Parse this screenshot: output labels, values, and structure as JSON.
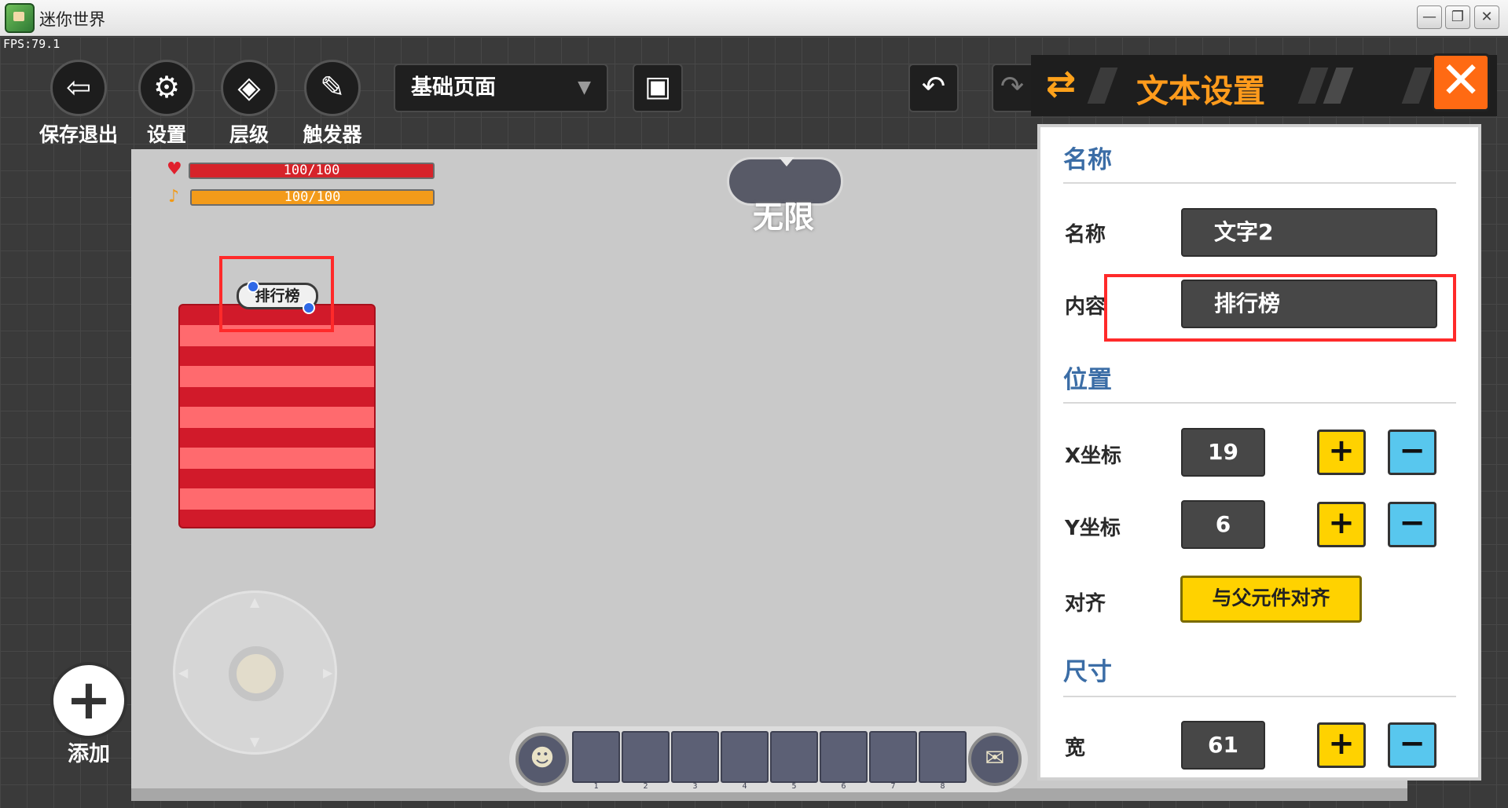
{
  "window": {
    "title": "迷你世界",
    "fps": "FPS:79.1",
    "minimize": "—",
    "maximize": "❐",
    "close": "✕"
  },
  "toolbar": {
    "items": [
      {
        "label": "保存退出",
        "icon": "exit-icon",
        "glyph": "⇦"
      },
      {
        "label": "设置",
        "icon": "gear-icon",
        "glyph": "⚙"
      },
      {
        "label": "层级",
        "icon": "layers-icon",
        "glyph": "◈"
      },
      {
        "label": "触发器",
        "icon": "edit-icon",
        "glyph": "✎"
      }
    ],
    "page_select": {
      "value": "基础页面",
      "dropdown_icon": "▼"
    },
    "preview_button": {
      "icon": "preview-icon",
      "glyph": "▣"
    },
    "undo": {
      "icon": "undo-icon",
      "glyph": "↶"
    },
    "redo": {
      "icon": "redo-icon",
      "glyph": "↷"
    }
  },
  "preview": {
    "hp": "100/100",
    "energy": "100/100",
    "hp_icon": "♥",
    "energy_icon": "♪",
    "mode_text": "无限",
    "widget_text": "排行榜",
    "joystick_arrows": {
      "up": "▲",
      "down": "▼",
      "left": "◀",
      "right": "▶"
    },
    "hotbar_left_glyph": "☻",
    "hotbar_right_glyph": "✉",
    "hotbar_slots": [
      "1",
      "2",
      "3",
      "4",
      "5",
      "6",
      "7",
      "8"
    ]
  },
  "add": {
    "glyph": "+",
    "label": "添加"
  },
  "panel": {
    "title": "文本设置",
    "swap_icon": "⇄",
    "close_glyph": "✕",
    "sections": {
      "name": "名称",
      "position": "位置",
      "size": "尺寸"
    },
    "fields": {
      "name_label": "名称",
      "name_value": "文字2",
      "content_label": "内容",
      "content_value": "排行榜",
      "x_label": "X坐标",
      "x_value": "19",
      "y_label": "Y坐标",
      "y_value": "6",
      "align_label": "对齐",
      "align_button": "与父元件对齐",
      "width_label": "宽",
      "width_value": "61"
    },
    "plus_glyph": "+",
    "minus_glyph": "−"
  },
  "colors": {
    "accent": "#ff9b1c",
    "section": "#3b6da6",
    "plus": "#ffd200",
    "minus": "#58c7ee",
    "highlight": "#ff2a2a"
  }
}
